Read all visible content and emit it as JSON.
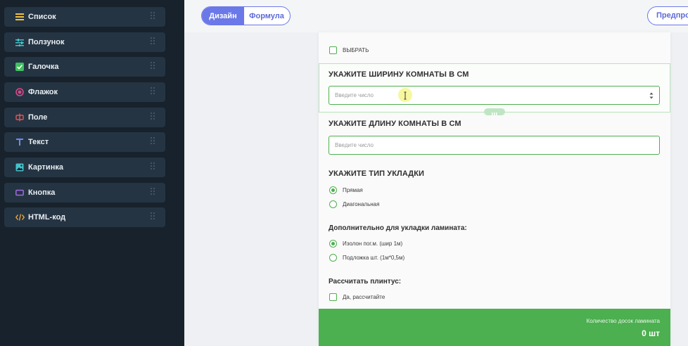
{
  "sidebar": {
    "items": [
      {
        "label": "Список",
        "icon": "list-icon",
        "color": "#f0c040"
      },
      {
        "label": "Ползунок",
        "icon": "slider-icon",
        "color": "#3ec3c9"
      },
      {
        "label": "Галочка",
        "icon": "checkbox-icon",
        "color": "#3fbf5f"
      },
      {
        "label": "Флажок",
        "icon": "radio-icon",
        "color": "#d64a8a"
      },
      {
        "label": "Поле",
        "icon": "field-icon",
        "color": "#e05555"
      },
      {
        "label": "Текст",
        "icon": "text-icon",
        "color": "#6d8cf0"
      },
      {
        "label": "Картинка",
        "icon": "image-icon",
        "color": "#45c2c9"
      },
      {
        "label": "Кнопка",
        "icon": "button-icon",
        "color": "#a06ae0"
      },
      {
        "label": "HTML-код",
        "icon": "code-icon",
        "color": "#f0a640"
      }
    ]
  },
  "header": {
    "tabs": [
      "Дизайн",
      "Формула"
    ],
    "preview_label": "Предпросмотр"
  },
  "form": {
    "select_label": "ВЫБРАТЬ",
    "q_width": {
      "title": "УКАЖИТЕ ШИРИНУ КОМНАТЫ В СМ",
      "placeholder": "Введите число"
    },
    "q_length": {
      "title": "УКАЖИТЕ ДЛИНУ КОМНАТЫ В СМ",
      "placeholder": "Введите число"
    },
    "q_type": {
      "title": "УКАЖИТЕ ТИП УКЛАДКИ",
      "options": [
        "Прямая",
        "Диагональная"
      ],
      "selected": 0
    },
    "q_extra": {
      "title": "Дополнительно для укладки ламината:",
      "options": [
        "Изолон пог.м. (шир 1м)",
        "Подложка шт. (1м*0,5м)"
      ],
      "selected": 0
    },
    "q_plinth": {
      "title": "Рассчитать плинтус:",
      "option": "Да, рассчитайте"
    },
    "result": {
      "label": "Количество досок ламината",
      "value": "0 шт"
    }
  },
  "colors": {
    "accent": "#6b78e8",
    "green": "#4caf50",
    "sidebar_bg": "#17222d"
  }
}
